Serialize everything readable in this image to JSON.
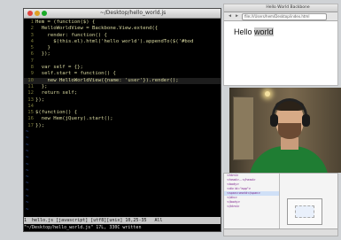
{
  "terminal": {
    "title": "~/Desktop/hello_world.js",
    "lines": [
      "Hem = (function($) {",
      "  HelloWorldView = Backbone.View.extend({",
      "    render: function() {",
      "      $(this.el).html('hello world').appendTo($('#bod",
      "    }",
      "  });",
      "",
      "  var self = {};",
      "  self.start = function() {",
      "    new HelloWorldView({name: 'user'}).render();",
      "  };",
      "  return self;",
      "});",
      "",
      "$(function() {",
      "  new Hem(jQuery).start();",
      "});",
      "~",
      "~",
      "~",
      "~",
      "~",
      "~",
      "~",
      "~",
      "~",
      "~",
      "~",
      "~",
      "~"
    ],
    "status_line": "1  hello.js [javascript] [utf8][unix] 10,25-35   All",
    "command_line": "\"~/Desktop/hello_world.js\" 17L, 330C written"
  },
  "browser": {
    "title": "Hello World Backbone",
    "url": "file:///Users/hem/Desktop/index.html",
    "content_prefix": "Hello ",
    "content_selected": "world"
  },
  "devtools": {
    "elements": [
      "<html>",
      " <head>...</head>",
      " <body>",
      "  <div id=\"app\">",
      "   <span>world</span>",
      "  </div>",
      " </body>",
      "</html>",
      "",
      "",
      "",
      ""
    ],
    "tabs": [
      "Elements",
      "Resources",
      "Network",
      "Scripts",
      "Console"
    ]
  },
  "colors": {
    "terminal_bg": "#000000",
    "code_fg": "#d9d9a0",
    "line_number": "#7a7a3a",
    "shirt": "#1f7d33"
  }
}
